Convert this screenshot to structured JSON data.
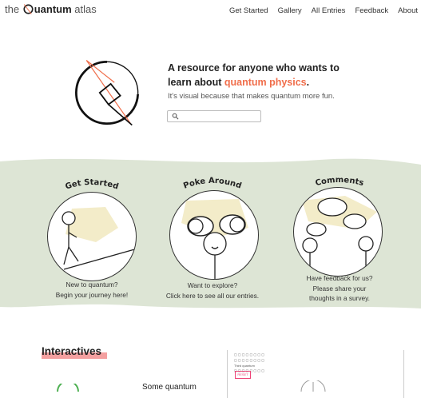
{
  "header": {
    "logo": {
      "prefix": "the",
      "q_word": "uantum",
      "suffix": "atlas"
    },
    "nav": [
      "Get Started",
      "Gallery",
      "All Entries",
      "Feedback",
      "About"
    ]
  },
  "hero": {
    "line1": "A resource for anyone who wants to",
    "line2_prefix": "learn about ",
    "line2_highlight": "quantum physics",
    "line2_suffix": ".",
    "subtitle": "It's visual because that makes quantum more fun.",
    "search": {
      "placeholder": "",
      "value": ""
    }
  },
  "cards": [
    {
      "title": "Get Started",
      "text1": "New to quantum?",
      "text2": "Begin your journey here!",
      "text3": ""
    },
    {
      "title": "Poke Around",
      "text1": "Want to explore?",
      "text2": "Click here to see all our entries.",
      "text3": ""
    },
    {
      "title": "Comments",
      "text1": "Have feedback for us?",
      "text2": "Please share your",
      "text3": "thoughts in a survey."
    }
  ],
  "interactives": {
    "title": "Interactives",
    "teaser": "Some quantum",
    "preview": {
      "line1": "Third quantum",
      "reset": "RESET"
    }
  },
  "colors": {
    "accent": "#f06e4b",
    "band": "#dde5d5",
    "highlight": "#f4a0a0",
    "sticky": "#f3ecc9"
  }
}
